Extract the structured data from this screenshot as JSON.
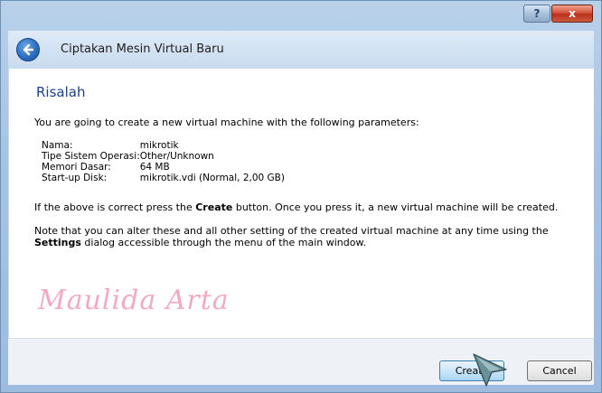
{
  "window": {
    "help_label": "?",
    "close_label": "x"
  },
  "header": {
    "dialog_title": "Ciptakan Mesin Virtual Baru"
  },
  "main": {
    "heading": "Risalah",
    "intro": "You are going to create a new virtual machine with the following parameters:",
    "parameters": [
      {
        "key": "Nama:",
        "value": "mikrotik"
      },
      {
        "key": "Tipe Sistem Operasi:",
        "value": "Other/Unknown"
      },
      {
        "key": "Memori Dasar:",
        "value": "64 MB"
      },
      {
        "key": "Start-up Disk:",
        "value": "mikrotik.vdi (Normal, 2,00 GB)"
      }
    ],
    "create_text_before": "If the above is correct press the ",
    "create_text_bold": "Create",
    "create_text_after": " button. Once you press it, a new virtual machine will be created.",
    "note_text_before": "Note that you can alter these and all other setting of the created virtual machine at any time using the ",
    "note_text_bold": "Settings",
    "note_text_after": " dialog accessible through the menu of the main window.",
    "watermark": "Maulida Arta"
  },
  "footer": {
    "create_label": "Create",
    "cancel_label": "Cancel"
  }
}
